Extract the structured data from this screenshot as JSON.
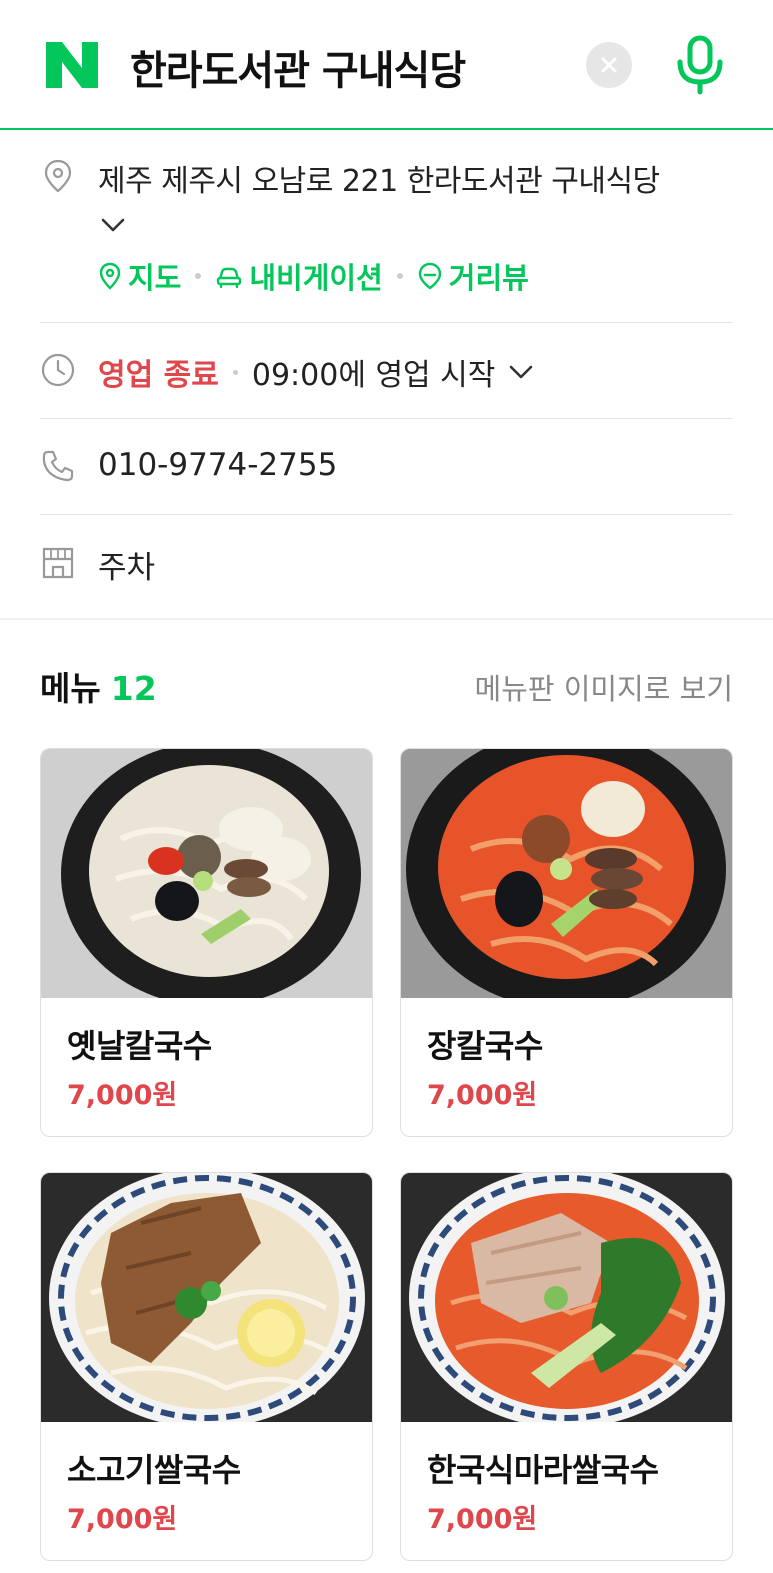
{
  "header": {
    "logo_letter": "N",
    "search_query": "한라도서관 구내식당"
  },
  "address": {
    "text": "제주 제주시 오남로 221 한라도서관 구내식당",
    "links": [
      {
        "label": "지도",
        "icon": "map-pin-icon"
      },
      {
        "label": "내비게이션",
        "icon": "car-icon"
      },
      {
        "label": "거리뷰",
        "icon": "street-view-icon"
      }
    ]
  },
  "hours": {
    "status": "영업 종료",
    "next_open": "09:00에 영업 시작"
  },
  "phone": "010-9774-2755",
  "facility": "주차",
  "menu": {
    "title": "메뉴",
    "count": "12",
    "view_image_link": "메뉴판 이미지로 보기",
    "items": [
      {
        "name": "옛날칼국수",
        "price": "7,000원",
        "photo": "clear-broth-noodle-bowl"
      },
      {
        "name": "장칼국수",
        "price": "7,000원",
        "photo": "spicy-red-noodle-bowl"
      },
      {
        "name": "소고기쌀국수",
        "price": "7,000원",
        "photo": "beef-rice-noodle-bowl"
      },
      {
        "name": "한국식마라쌀국수",
        "price": "7,000원",
        "photo": "mala-rice-noodle-bowl"
      }
    ]
  },
  "colors": {
    "brand_green": "#03c75a",
    "closed_red": "#e0474c",
    "price_red": "#e0474c"
  }
}
